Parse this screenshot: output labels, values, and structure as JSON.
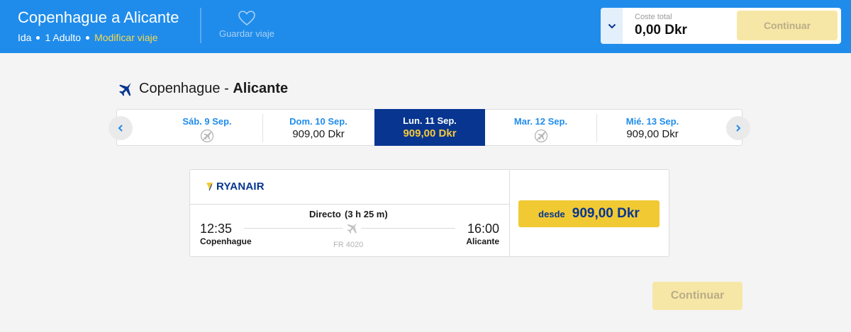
{
  "header": {
    "title": "Copenhague a Alicante",
    "trip_type": "Ida",
    "passengers": "1 Adulto",
    "modify_link": "Modificar viaje",
    "save_trip": "Guardar viaje",
    "cost_label": "Coste total",
    "cost_value": "0,00 Dkr",
    "continue_label": "Continuar"
  },
  "route": {
    "origin": "Copenhague",
    "separator": " - ",
    "destination": "Alicante"
  },
  "dates": [
    {
      "label": "Sáb. 9 Sep.",
      "price": "",
      "selected": false,
      "no_flight": true
    },
    {
      "label": "Dom. 10 Sep.",
      "price": "909,00 Dkr",
      "selected": false,
      "no_flight": false
    },
    {
      "label": "Lun. 11 Sep.",
      "price": "909,00 Dkr",
      "selected": true,
      "no_flight": false
    },
    {
      "label": "Mar. 12 Sep.",
      "price": "",
      "selected": false,
      "no_flight": true
    },
    {
      "label": "Mié. 13 Sep.",
      "price": "909,00 Dkr",
      "selected": false,
      "no_flight": false
    }
  ],
  "flight": {
    "airline": "RYANAIR",
    "type": "Directo",
    "duration": "(3 h 25 m)",
    "departure_time": "12:35",
    "departure_city": "Copenhague",
    "arrival_time": "16:00",
    "arrival_city": "Alicante",
    "flight_number": "FR 4020",
    "price_prefix": "desde",
    "price": "909,00 Dkr"
  },
  "footer": {
    "continue_label": "Continuar"
  },
  "colors": {
    "header_bg": "#1f8ceb",
    "brand_navy": "#073590",
    "accent_yellow": "#f1c933",
    "disabled_yellow": "#f7e7a7"
  },
  "icons": {
    "save": "heart-icon",
    "cost_toggle": "chevron-down-icon",
    "route": "airplane-icon",
    "prev": "chevron-left-icon",
    "next": "chevron-right-icon",
    "no_flight": "no-flight-icon"
  }
}
